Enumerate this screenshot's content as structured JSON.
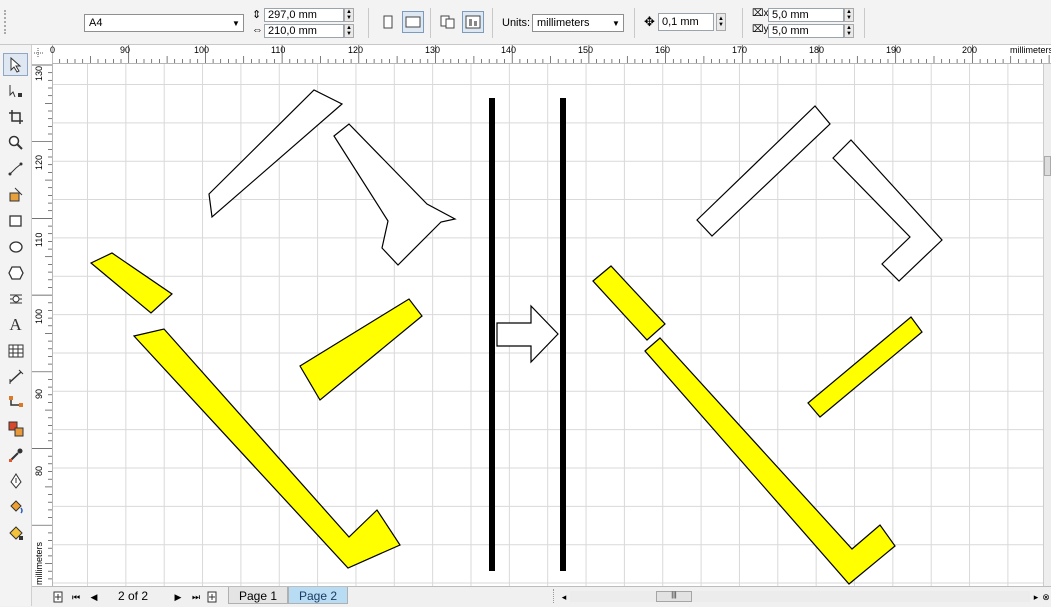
{
  "property_bar": {
    "paper_size": "A4",
    "page_width": "297,0 mm",
    "page_height": "210,0 mm",
    "units_label": "Units:",
    "units_value": "millimeters",
    "nudge_distance": "0,1 mm",
    "duplicate_x": "5,0 mm",
    "duplicate_y": "5,0 mm"
  },
  "toolbox": {
    "tools": [
      "pick-tool",
      "shape-tool",
      "crop-tool",
      "zoom-tool",
      "freehand-tool",
      "smart-fill-tool",
      "rectangle-tool",
      "ellipse-tool",
      "polygon-tool",
      "basic-shapes-tool",
      "text-tool",
      "table-tool",
      "dimension-tool",
      "connector-tool",
      "blend-tool",
      "eyedropper-tool",
      "outline-tool",
      "fill-tool",
      "interactive-fill-tool"
    ]
  },
  "rulers": {
    "unit_label": "millimeters",
    "horizontal_ticks": [
      "0",
      "90",
      "100",
      "110",
      "120",
      "130",
      "140",
      "150",
      "160",
      "170",
      "180",
      "190",
      "200"
    ],
    "vertical_ticks": [
      "130",
      "120",
      "110",
      "100",
      "90",
      "80"
    ]
  },
  "page_nav": {
    "counter": "2 of 2",
    "pages": [
      {
        "label": "Page 1",
        "active": false
      },
      {
        "label": "Page 2",
        "active": true
      }
    ]
  },
  "colors": {
    "shape_fill": "#ffff00",
    "outline": "#000000",
    "active_tab": "#b8dcf3",
    "grid": "#d9d9d9"
  }
}
